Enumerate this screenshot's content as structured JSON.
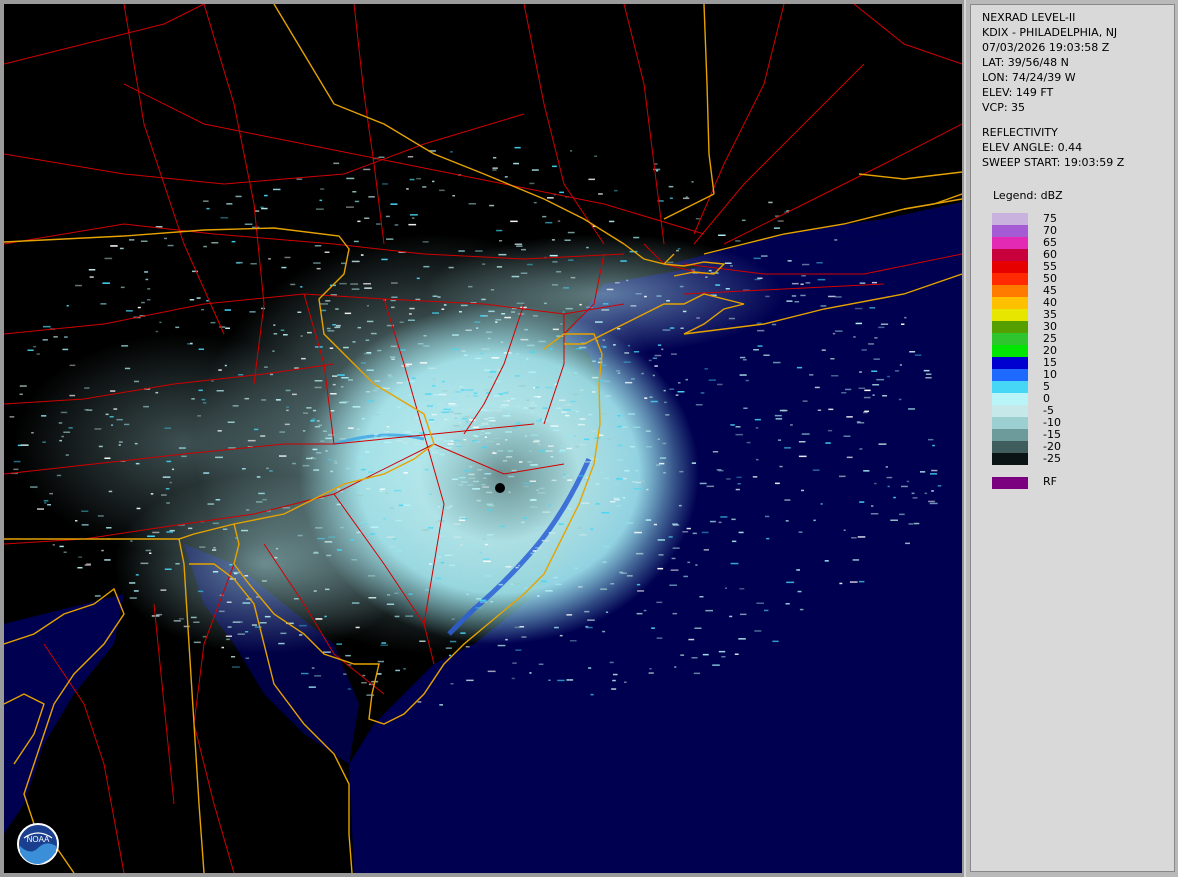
{
  "info": {
    "product": "NEXRAD LEVEL-II",
    "station": "KDIX - PHILADELPHIA, NJ",
    "datetime": "07/03/2026 19:03:58 Z",
    "lat": "LAT: 39/56/48 N",
    "lon": "LON: 74/24/39 W",
    "elev": "ELEV: 149 FT",
    "vcp": "VCP: 35",
    "moment": "REFLECTIVITY",
    "elev_angle": "ELEV ANGLE: 0.44",
    "sweep_start": "SWEEP START: 19:03:59 Z"
  },
  "legend": {
    "title": "Legend: dBZ",
    "items": [
      {
        "label": "75",
        "color": "#c9b2dd"
      },
      {
        "label": "70",
        "color": "#a55bd3"
      },
      {
        "label": "65",
        "color": "#e22ab5"
      },
      {
        "label": "60",
        "color": "#c8003c"
      },
      {
        "label": "55",
        "color": "#e60000"
      },
      {
        "label": "50",
        "color": "#ff2a00"
      },
      {
        "label": "45",
        "color": "#ff7b00"
      },
      {
        "label": "40",
        "color": "#ffc000"
      },
      {
        "label": "35",
        "color": "#e6e600"
      },
      {
        "label": "30",
        "color": "#55a000"
      },
      {
        "label": "25",
        "color": "#2fc52f"
      },
      {
        "label": "20",
        "color": "#00e600"
      },
      {
        "label": "15",
        "color": "#0000d0"
      },
      {
        "label": "10",
        "color": "#1e6aff"
      },
      {
        "label": "5",
        "color": "#45d7f5"
      },
      {
        "label": "0",
        "color": "#b8f4f8"
      },
      {
        "label": "-5",
        "color": "#c6e8e8"
      },
      {
        "label": "-10",
        "color": "#9ccfcf"
      },
      {
        "label": "-15",
        "color": "#6d9a9a"
      },
      {
        "label": "-20",
        "color": "#3f5d5d"
      },
      {
        "label": "-25",
        "color": "#0a1414"
      }
    ],
    "rf_label": "RF",
    "rf_color": "#7b0080"
  },
  "map": {
    "land_color": "#000000",
    "ocean_color": "#000050",
    "state_border_color": "#e6a300",
    "road_color": "#d00000",
    "radar_site": "KDIX"
  },
  "logo": {
    "text": "NOAA"
  }
}
